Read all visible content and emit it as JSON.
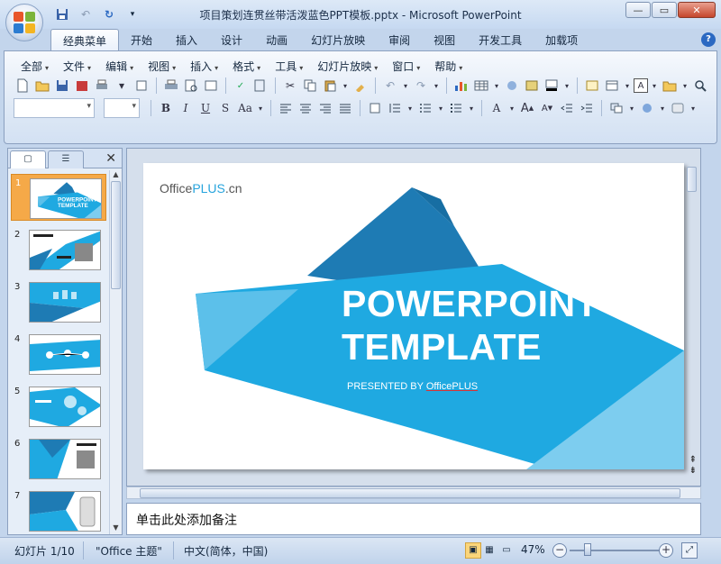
{
  "window": {
    "title": "项目策划连贯丝带活泼蓝色PPT模板.pptx - Microsoft PowerPoint"
  },
  "ribbon_tabs": [
    {
      "label": "经典菜单",
      "active": true
    },
    {
      "label": "开始"
    },
    {
      "label": "插入"
    },
    {
      "label": "设计"
    },
    {
      "label": "动画"
    },
    {
      "label": "幻灯片放映"
    },
    {
      "label": "审阅"
    },
    {
      "label": "视图"
    },
    {
      "label": "开发工具"
    },
    {
      "label": "加载项"
    }
  ],
  "menus": [
    {
      "label": "全部"
    },
    {
      "label": "文件"
    },
    {
      "label": "编辑"
    },
    {
      "label": "视图"
    },
    {
      "label": "插入"
    },
    {
      "label": "格式"
    },
    {
      "label": "工具"
    },
    {
      "label": "幻灯片放映"
    },
    {
      "label": "窗口"
    },
    {
      "label": "帮助"
    }
  ],
  "format": {
    "bold": "B",
    "italic": "I",
    "underline": "U",
    "shadow": "S",
    "case": "Aa",
    "font_color": "A"
  },
  "thumbnails": [
    {
      "num": "1",
      "selected": true
    },
    {
      "num": "2"
    },
    {
      "num": "3"
    },
    {
      "num": "4"
    },
    {
      "num": "5"
    },
    {
      "num": "6"
    },
    {
      "num": "7"
    }
  ],
  "slide": {
    "logo_prefix": "Office",
    "logo_plus": "PLUS",
    "logo_suffix": ".cn",
    "title": "POWERPOINT\nTEMPLATE",
    "presented_by": "PRESENTED BY ",
    "presented_brand": "OfficePLUS",
    "colors": {
      "ribbon_dark": "#1e7bb4",
      "ribbon_mid": "#1fa9e1",
      "ribbon_light": "#5cc0ea",
      "ribbon_pale": "#7dcdef"
    }
  },
  "notes": {
    "placeholder": "单击此处添加备注"
  },
  "status": {
    "slide_info": "幻灯片 1/10",
    "theme": "\"Office 主题\"",
    "language": "中文(简体，中国)",
    "zoom": "47%"
  }
}
